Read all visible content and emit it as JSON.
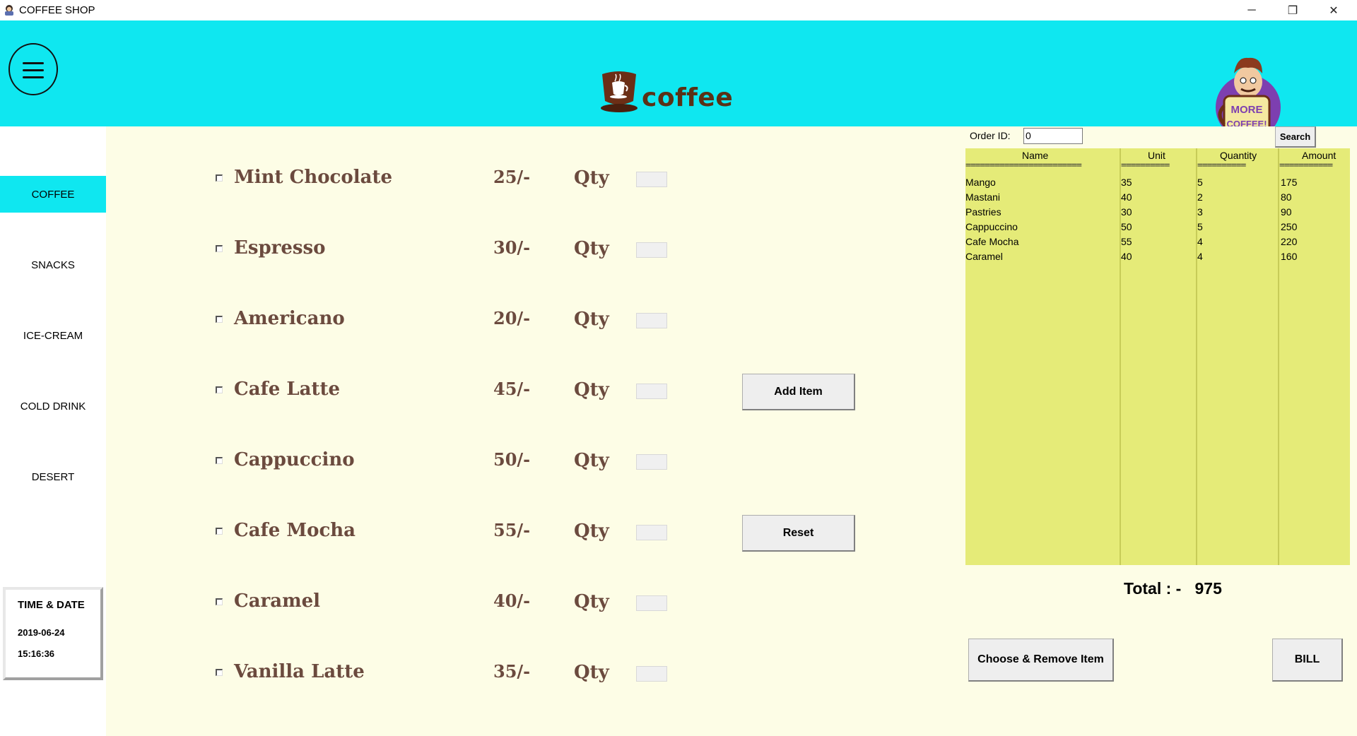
{
  "window": {
    "title": "COFFEE SHOP",
    "controls": {
      "minimize": "─",
      "restore": "❐",
      "close": "✕"
    }
  },
  "header": {
    "logo_text": "coffee",
    "bg_color": "#0fe7f0",
    "mascot_text": [
      "MORE",
      "COFFEE!"
    ]
  },
  "sidebar": {
    "items": [
      {
        "label": "COFFEE",
        "active": true
      },
      {
        "label": "SNACKS",
        "active": false
      },
      {
        "label": "ICE-CREAM",
        "active": false
      },
      {
        "label": "COLD DRINK",
        "active": false
      },
      {
        "label": "DESERT",
        "active": false
      }
    ],
    "time_panel": {
      "title": "TIME & DATE",
      "date": "2019-06-24",
      "time": "15:16:36"
    }
  },
  "menu": {
    "qty_label": "Qty",
    "items": [
      {
        "name": "Mint Chocolate",
        "price": "25/-"
      },
      {
        "name": "Espresso",
        "price": "30/-"
      },
      {
        "name": "Americano",
        "price": "20/-"
      },
      {
        "name": "Cafe Latte",
        "price": "45/-"
      },
      {
        "name": "Cappuccino",
        "price": "50/-"
      },
      {
        "name": "Cafe Mocha",
        "price": "55/-"
      },
      {
        "name": "Caramel",
        "price": "40/-"
      },
      {
        "name": "Vanilla Latte",
        "price": "35/-"
      }
    ],
    "add_button": "Add Item",
    "reset_button": "Reset"
  },
  "order": {
    "order_id_label": "Order ID:",
    "order_id_value": "0",
    "search_button": "Search",
    "columns": [
      "Name",
      "Unit",
      "Quantity",
      "Amount"
    ],
    "separators": [
      "========================",
      "==========",
      "==========",
      "==========="
    ],
    "rows": [
      {
        "name": "Mango",
        "unit": "35",
        "quantity": "5",
        "amount": "175"
      },
      {
        "name": "Mastani",
        "unit": "40",
        "quantity": "2",
        "amount": "80"
      },
      {
        "name": "Pastries",
        "unit": "30",
        "quantity": "3",
        "amount": "90"
      },
      {
        "name": "Cappuccino",
        "unit": "50",
        "quantity": "5",
        "amount": "250"
      },
      {
        "name": "Cafe Mocha",
        "unit": "55",
        "quantity": "4",
        "amount": "220"
      },
      {
        "name": "Caramel",
        "unit": "40",
        "quantity": "4",
        "amount": "160"
      }
    ],
    "total_label": "Total : -",
    "total_value": "975",
    "remove_button": "Choose & Remove Item",
    "bill_button": "BILL"
  }
}
